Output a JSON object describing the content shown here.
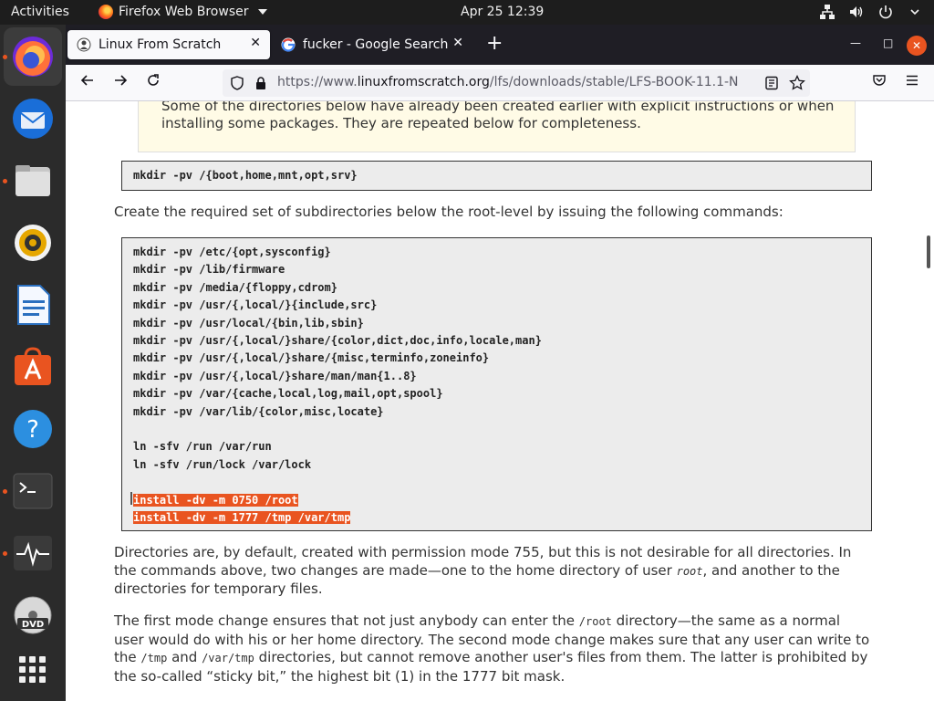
{
  "topbar": {
    "activities": "Activities",
    "app_name": "Firefox Web Browser",
    "clock": "Apr 25  12:39"
  },
  "dock": {
    "items": [
      "firefox-icon",
      "thunderbird-icon",
      "files-icon",
      "rhythmbox-icon",
      "libreoffice-writer-icon",
      "app-center-icon",
      "help-icon",
      "terminal-icon",
      "system-monitor-icon",
      "dvd-icon",
      "show-apps-icon"
    ]
  },
  "tabs": [
    {
      "title": "Linux From Scratch",
      "active": true
    },
    {
      "title": "fucker - Google Search",
      "active": false
    }
  ],
  "navbar": {
    "url_prefix": "https://www.",
    "url_host": "linuxfromscratch.org",
    "url_path": "/lfs/downloads/stable/LFS-BOOK-11.1-N"
  },
  "content": {
    "note_text": "Some of the directories below have already been created earlier with explicit instructions or when installing some packages. They are repeated below for completeness.",
    "code1": "mkdir -pv /{boot,home,mnt,opt,srv}",
    "intro": "Create the required set of subdirectories below the root-level by issuing the following commands:",
    "code2_lines": [
      "mkdir -pv /etc/{opt,sysconfig}",
      "mkdir -pv /lib/firmware",
      "mkdir -pv /media/{floppy,cdrom}",
      "mkdir -pv /usr/{,local/}{include,src}",
      "mkdir -pv /usr/local/{bin,lib,sbin}",
      "mkdir -pv /usr/{,local/}share/{color,dict,doc,info,locale,man}",
      "mkdir -pv /usr/{,local/}share/{misc,terminfo,zoneinfo}",
      "mkdir -pv /usr/{,local/}share/man/man{1..8}",
      "mkdir -pv /var/{cache,local,log,mail,opt,spool}",
      "mkdir -pv /var/lib/{color,misc,locate}"
    ],
    "code2_ln": [
      "ln -sfv /run /var/run",
      "ln -sfv /run/lock /var/lock"
    ],
    "code2_selected": [
      "install -dv -m 0750 /root",
      "install -dv -m 1777 /tmp /var/tmp"
    ],
    "para1_a": "Directories are, by default, created with permission mode 755, but this is not desirable for all directories. In the commands above, two changes are made—one to the home directory of user ",
    "para1_code": "root",
    "para1_b": ", and another to the directories for temporary files.",
    "para2_a": "The first mode change ensures that not just anybody can enter the ",
    "para2_code1": "/root",
    "para2_b": " directory—the same as a normal user would do with his or her home directory. The second mode change makes sure that any user can write to the ",
    "para2_code2": "/tmp",
    "para2_c": " and ",
    "para2_code3": "/var/tmp",
    "para2_d": " directories, but cannot remove another user's files from them. The latter is prohibited by the so-called “sticky bit,” the highest bit (1) in the 1777 bit mask."
  }
}
